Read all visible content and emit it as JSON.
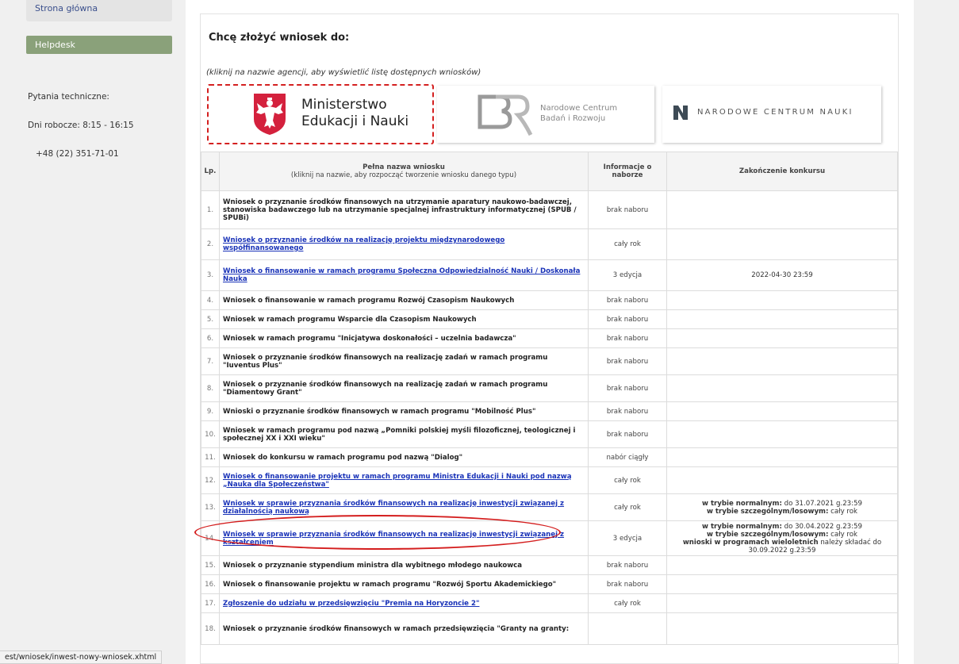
{
  "sidebar": {
    "home_label": "Strona główna",
    "helpdesk_label": "Helpdesk",
    "help_lines": [
      "Pytania techniczne:",
      "Dni robocze: 8:15 - 16:15",
      "   +48 (22) 351-71-01"
    ]
  },
  "main": {
    "heading": "Chcę złożyć wniosek do:",
    "hint": "(kliknij na nazwie agencji, aby wyświetlić listę dostępnych wniosków)"
  },
  "logos": {
    "mein_line1": "Ministerstwo",
    "mein_line2": "Edukacji i Nauki",
    "ncbr_line1": "Narodowe Centrum",
    "ncbr_line2": "Badań i Rozwoju",
    "ncn": "NARODOWE CENTRUM NAUKI"
  },
  "table": {
    "headers": {
      "lp": "Lp.",
      "name": "Pełna nazwa wniosku",
      "name_sub": "(kliknij na nazwie, aby rozpocząć tworzenie wniosku danego typu)",
      "info": "Informacje o naborze",
      "end": "Zakończenie konkursu"
    },
    "rows": [
      {
        "lp": "1.",
        "name": "Wniosek o przyznanie środków finansowych na utrzymanie aparatury naukowo-badawczej, stanowiska badawczego lub na utrzymanie specjalnej infrastruktury informatycznej (SPUB / SPUBi)",
        "info": "brak naboru",
        "end": "",
        "link": false
      },
      {
        "lp": "2.",
        "name": "Wniosek o przyznanie środków na realizację projektu międzynarodowego współfinansowanego",
        "info": "cały rok",
        "end": "",
        "link": true
      },
      {
        "lp": "3.",
        "name": "Wniosek o finansowanie w ramach programu Społeczna Odpowiedzialność Nauki / Doskonała Nauka",
        "info": "3 edycja",
        "end": "2022-04-30 23:59",
        "link": true
      },
      {
        "lp": "4.",
        "name": "Wniosek o finansowanie w ramach programu Rozwój Czasopism Naukowych",
        "info": "brak naboru",
        "end": "",
        "link": false
      },
      {
        "lp": "5.",
        "name": "Wniosek w ramach programu Wsparcie dla Czasopism Naukowych",
        "info": "brak naboru",
        "end": "",
        "link": false
      },
      {
        "lp": "6.",
        "name": "Wniosek w ramach programu \"Inicjatywa doskonałości – uczelnia badawcza\"",
        "info": "brak naboru",
        "end": "",
        "link": false
      },
      {
        "lp": "7.",
        "name": "Wniosek o przyznanie środków finansowych na realizację zadań w ramach programu \"Iuventus Plus\"",
        "info": "brak naboru",
        "end": "",
        "link": false
      },
      {
        "lp": "8.",
        "name": "Wniosek o przyznanie środków finansowych na realizację zadań w ramach programu \"Diamentowy Grant\"",
        "info": "brak naboru",
        "end": "",
        "link": false
      },
      {
        "lp": "9.",
        "name": "Wnioski o przyznanie środków finansowych w ramach programu \"Mobilność Plus\"",
        "info": "brak naboru",
        "end": "",
        "link": false
      },
      {
        "lp": "10.",
        "name": "Wniosek w ramach programu pod nazwą „Pomniki polskiej myśli filozoficznej, teologicznej i społecznej XX i XXI wieku\"",
        "info": "brak naboru",
        "end": "",
        "link": false
      },
      {
        "lp": "11.",
        "name": "Wniosek do konkursu w ramach programu pod nazwą \"Dialog\"",
        "info": "nabór ciągły",
        "end": "",
        "link": false
      },
      {
        "lp": "12.",
        "name": "Wniosek o finansowanie projektu w ramach programu Ministra Edukacji i Nauki pod nazwą „Nauka dla Społeczeństwa\"",
        "info": "cały rok",
        "end": "",
        "link": true
      },
      {
        "lp": "13.",
        "name": "Wniosek w sprawie przyznania środków finansowych na realizację inwestycji związanej z działalnością naukową",
        "info": "cały rok",
        "end_lines": [
          [
            "w trybie normalnym:",
            " do 31.07.2021 g.23:59"
          ],
          [
            "w trybie szczególnym/losowym:",
            " cały rok"
          ]
        ],
        "link": true
      },
      {
        "lp": "14.",
        "name": "Wniosek w sprawie przyznania środków finansowych na realizację inwestycji związanej z kształceniem",
        "info": "3 edycja",
        "end_lines": [
          [
            "w trybie normalnym:",
            " do 30.04.2022 g.23:59"
          ],
          [
            "w trybie szczególnym/losowym:",
            " cały rok"
          ],
          [
            "wnioski w programach wieloletnich",
            " należy składać do 30.09.2022 g.23:59"
          ]
        ],
        "link": true
      },
      {
        "lp": "15.",
        "name": "Wniosek o przyznanie stypendium ministra dla wybitnego młodego naukowca",
        "info": "brak naboru",
        "end": "",
        "link": false
      },
      {
        "lp": "16.",
        "name": "Wniosek o finansowanie projektu w ramach programu \"Rozwój Sportu Akademickiego\"",
        "info": "brak naboru",
        "end": "",
        "link": false
      },
      {
        "lp": "17.",
        "name": "Zgłoszenie do udziału w przedsięwzięciu \"Premia na Horyzoncie 2\"",
        "info": "cały rok",
        "end": "",
        "link": true
      },
      {
        "lp": "18.",
        "name": "Wniosek o przyznanie środków finansowych w ramach przedsięwzięcia \"Granty na granty:",
        "info": "",
        "end": "",
        "link": false
      }
    ]
  },
  "statusbar": {
    "url": "est/wniosek/inwest-nowy-wniosek.xhtml"
  },
  "colors": {
    "link": "#1a33b8",
    "helpdesk_bg": "#8aa17a",
    "highlight": "#d41e1e"
  }
}
